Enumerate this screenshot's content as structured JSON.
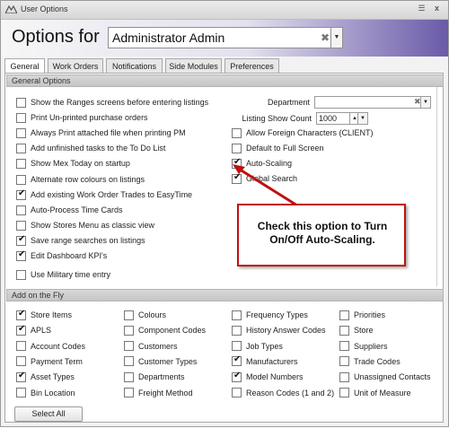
{
  "window": {
    "title": "User Options",
    "close": "x",
    "settings": "☰"
  },
  "header": {
    "label": "Options for",
    "user_value": "Administrator Admin",
    "clear": "✖",
    "dropdown": "▼"
  },
  "tabs": [
    "General",
    "Work Orders",
    "Notifications",
    "Side Modules",
    "Preferences"
  ],
  "general": {
    "heading": "General Options",
    "left": [
      {
        "label": "Show the Ranges screens before entering listings",
        "checked": false
      },
      {
        "label": "Print Un-printed purchase orders",
        "checked": false
      },
      {
        "label": "Always Print attached file when printing PM",
        "checked": false
      },
      {
        "label": "Add unfinished tasks to the To Do List",
        "checked": false
      },
      {
        "label": "Show Mex Today on startup",
        "checked": false
      },
      {
        "label": "Alternate row colours on listings",
        "checked": false
      },
      {
        "label": "Add existing Work Order Trades to EasyTime",
        "checked": true
      },
      {
        "label": "Auto-Process Time Cards",
        "checked": false
      },
      {
        "label": "Show Stores Menu as classic view",
        "checked": false
      },
      {
        "label": "Save range searches on listings",
        "checked": true
      },
      {
        "label": "Edit Dashboard KPI's",
        "checked": true
      },
      {
        "label": "Use Military time entry",
        "checked": false
      }
    ],
    "department_label": "Department",
    "department_clear": "✖",
    "department_dropdown": "▼",
    "listing_count_label": "Listing Show Count",
    "listing_count_value": "1000",
    "listing_spin": "▲",
    "listing_dropdown": "▼",
    "right": [
      {
        "label": "Allow Foreign Characters (CLIENT)",
        "checked": false
      },
      {
        "label": "Default to Full Screen",
        "checked": false
      },
      {
        "label": "Auto-Scaling",
        "checked": true
      },
      {
        "label": "Global Search",
        "checked": true
      }
    ]
  },
  "callout": {
    "text": "Check this option to Turn On/Off Auto-Scaling.",
    "color": "#c01010"
  },
  "fly": {
    "heading": "Add on the Fly",
    "columns": [
      [
        {
          "label": "Store Items",
          "checked": true
        },
        {
          "label": "APLS",
          "checked": true
        },
        {
          "label": "Account Codes",
          "checked": false
        },
        {
          "label": "Payment Term",
          "checked": false
        },
        {
          "label": "Asset Types",
          "checked": true
        },
        {
          "label": "Bin Location",
          "checked": false
        }
      ],
      [
        {
          "label": "Colours",
          "checked": false
        },
        {
          "label": "Component Codes",
          "checked": false
        },
        {
          "label": "Customers",
          "checked": false
        },
        {
          "label": "Customer Types",
          "checked": false
        },
        {
          "label": "Departments",
          "checked": false
        },
        {
          "label": "Freight Method",
          "checked": false
        }
      ],
      [
        {
          "label": "Frequency Types",
          "checked": false
        },
        {
          "label": "History Answer Codes",
          "checked": false
        },
        {
          "label": "Job Types",
          "checked": false
        },
        {
          "label": "Manufacturers",
          "checked": true
        },
        {
          "label": "Model Numbers",
          "checked": true
        },
        {
          "label": "Reason Codes (1 and 2)",
          "checked": false
        }
      ],
      [
        {
          "label": "Priorities",
          "checked": false
        },
        {
          "label": "Store",
          "checked": false
        },
        {
          "label": "Suppliers",
          "checked": false
        },
        {
          "label": "Trade Codes",
          "checked": false
        },
        {
          "label": "Unassigned Contacts",
          "checked": false
        },
        {
          "label": "Unit of Measure",
          "checked": false
        }
      ]
    ],
    "select_all": "Select All"
  },
  "tick_glyph": "✔"
}
